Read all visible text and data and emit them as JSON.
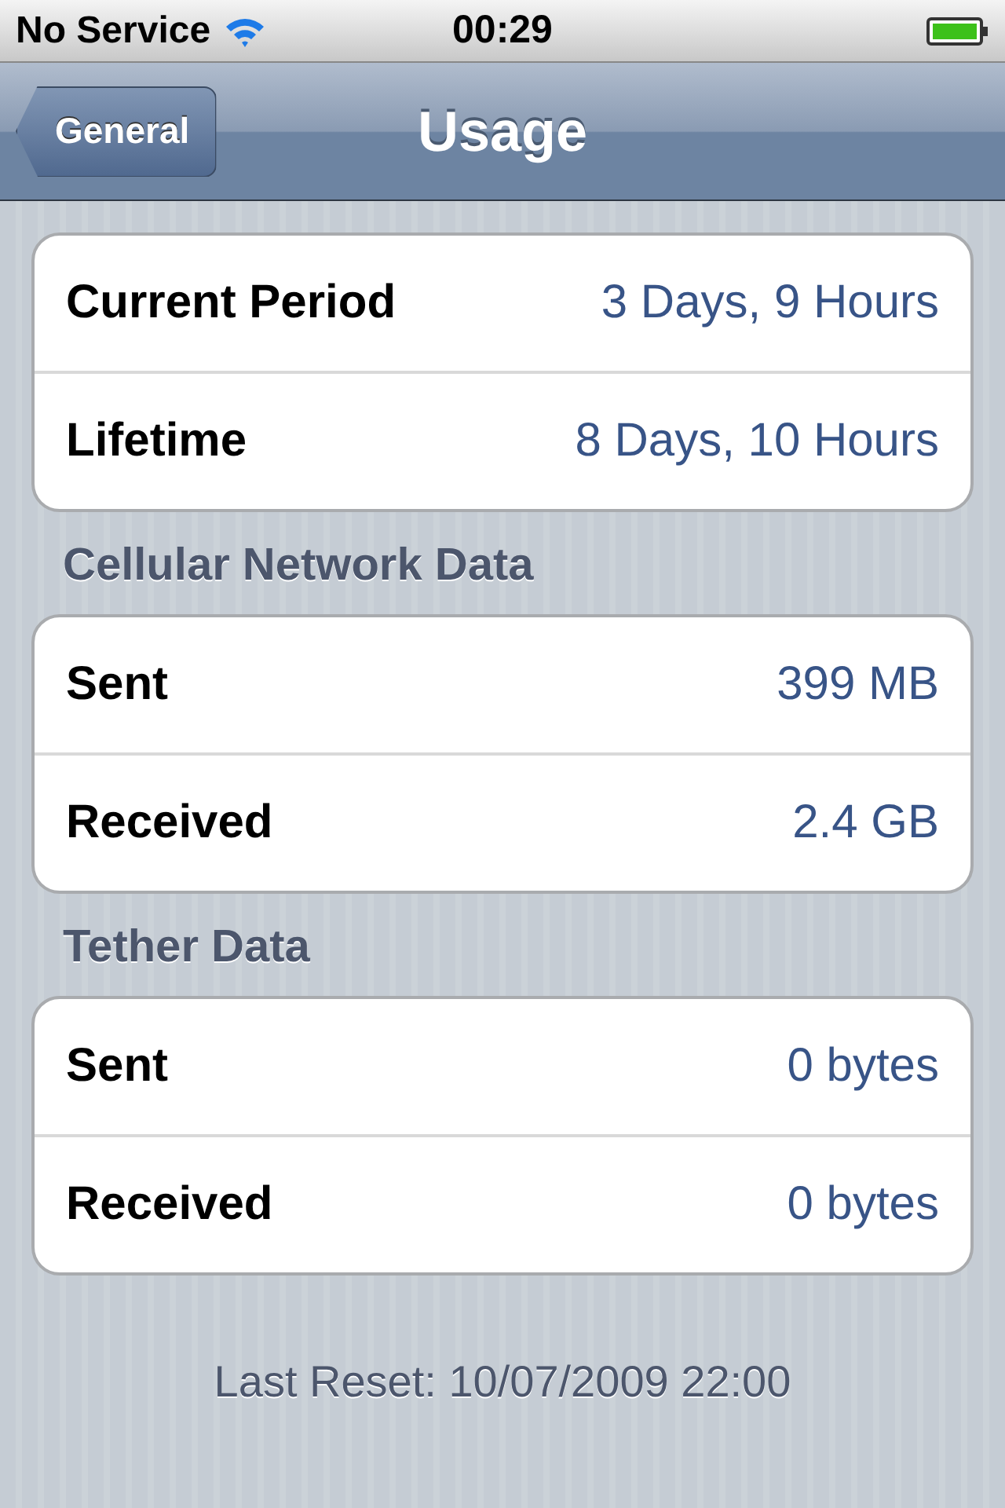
{
  "status_bar": {
    "carrier": "No Service",
    "time": "00:29"
  },
  "nav_bar": {
    "back_button": "General",
    "title": "Usage"
  },
  "sections": [
    {
      "rows": [
        {
          "label": "Current Period",
          "value": "3 Days, 9 Hours"
        },
        {
          "label": "Lifetime",
          "value": "8 Days, 10 Hours"
        }
      ]
    },
    {
      "header": "Cellular Network Data",
      "rows": [
        {
          "label": "Sent",
          "value": "399 MB"
        },
        {
          "label": "Received",
          "value": "2.4 GB"
        }
      ]
    },
    {
      "header": "Tether Data",
      "rows": [
        {
          "label": "Sent",
          "value": "0 bytes"
        },
        {
          "label": "Received",
          "value": "0 bytes"
        }
      ]
    }
  ],
  "footer": "Last Reset: 10/07/2009 22:00"
}
